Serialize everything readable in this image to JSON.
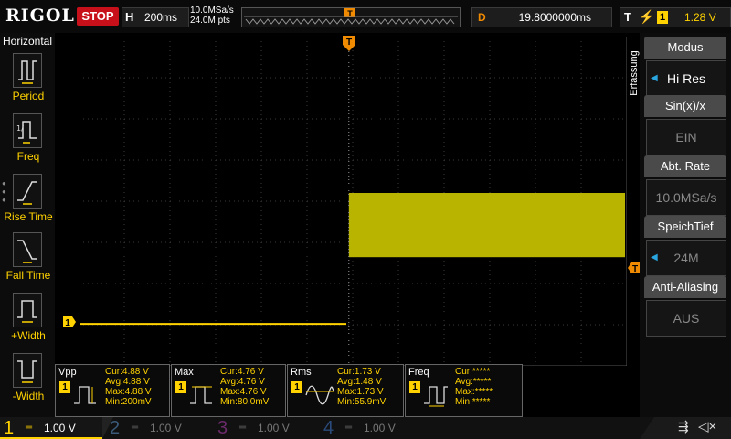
{
  "header": {
    "brand": "RIGOL",
    "run_state": "STOP",
    "timebase_label": "H",
    "timebase_value": "200ms",
    "sample_rate": "10.0MSa/s",
    "memory_points": "24.0M pts",
    "trigger_marker": "T",
    "delay_label": "D",
    "delay_value": "19.8000000ms",
    "trigger_label": "T",
    "trigger_edge": "rising-edge-icon",
    "trigger_source": "1",
    "trigger_level": "1.28 V"
  },
  "left_menu": {
    "title": "Horizontal",
    "items": [
      {
        "label": "Period",
        "icon": "period-icon"
      },
      {
        "label": "Freq",
        "icon": "frequency-icon"
      },
      {
        "label": "Rise Time",
        "icon": "rise-time-icon"
      },
      {
        "label": "Fall Time",
        "icon": "fall-time-icon"
      },
      {
        "label": "+Width",
        "icon": "positive-width-icon"
      },
      {
        "label": "-Width",
        "icon": "negative-width-icon"
      }
    ]
  },
  "right_menu": {
    "section_label": "Erfassung",
    "items": [
      {
        "title": "Modus",
        "value": "Hi Res",
        "active": true
      },
      {
        "title": "Sin(x)/x",
        "value": "EIN",
        "active": false
      },
      {
        "title": "Abt. Rate",
        "value": "10.0MSa/s",
        "active": false
      },
      {
        "title": "SpeichTief",
        "value": "24M",
        "active": false
      },
      {
        "title": "Anti-Aliasing",
        "value": "AUS",
        "active": false
      }
    ]
  },
  "waveform": {
    "channel_marker": "1",
    "trigger_level_marker": "T",
    "pre_trigger_level_fraction": 0.867,
    "post_trigger_band_top_fraction": 0.475,
    "post_trigger_band_bottom_fraction": 0.67,
    "trigger_time_fraction": 0.493,
    "trace_color": "#b8b400"
  },
  "measurements": [
    {
      "name": "Vpp",
      "icon": "vpp-wave-icon",
      "channel": "1",
      "cur": "Cur:4.88 V",
      "avg": "Avg:4.88 V",
      "max": "Max:4.88 V",
      "min": "Min:200mV"
    },
    {
      "name": "Max",
      "icon": "vmax-wave-icon",
      "channel": "1",
      "cur": "Cur:4.76 V",
      "avg": "Avg:4.76 V",
      "max": "Max:4.76 V",
      "min": "Min:80.0mV"
    },
    {
      "name": "Rms",
      "icon": "rms-wave-icon",
      "channel": "1",
      "cur": "Cur:1.73 V",
      "avg": "Avg:1.48 V",
      "max": "Max:1.73 V",
      "min": "Min:55.9mV"
    },
    {
      "name": "Freq",
      "icon": "freq-wave-icon",
      "channel": "1",
      "cur": "Cur:*****",
      "avg": "Avg:*****",
      "max": "Max:*****",
      "min": "Min:*****"
    }
  ],
  "channels": [
    {
      "number": "1",
      "scale": "1.00 V",
      "color": "#ffd200",
      "active": true
    },
    {
      "number": "2",
      "scale": "1.00 V",
      "color": "#3a9ad9",
      "active": false
    },
    {
      "number": "3",
      "scale": "1.00 V",
      "color": "#d63fd6",
      "active": false
    },
    {
      "number": "4",
      "scale": "1.00 V",
      "color": "#2f6fd6",
      "active": false
    }
  ],
  "status_icons": [
    "usb-icon",
    "speaker-muted-icon"
  ]
}
